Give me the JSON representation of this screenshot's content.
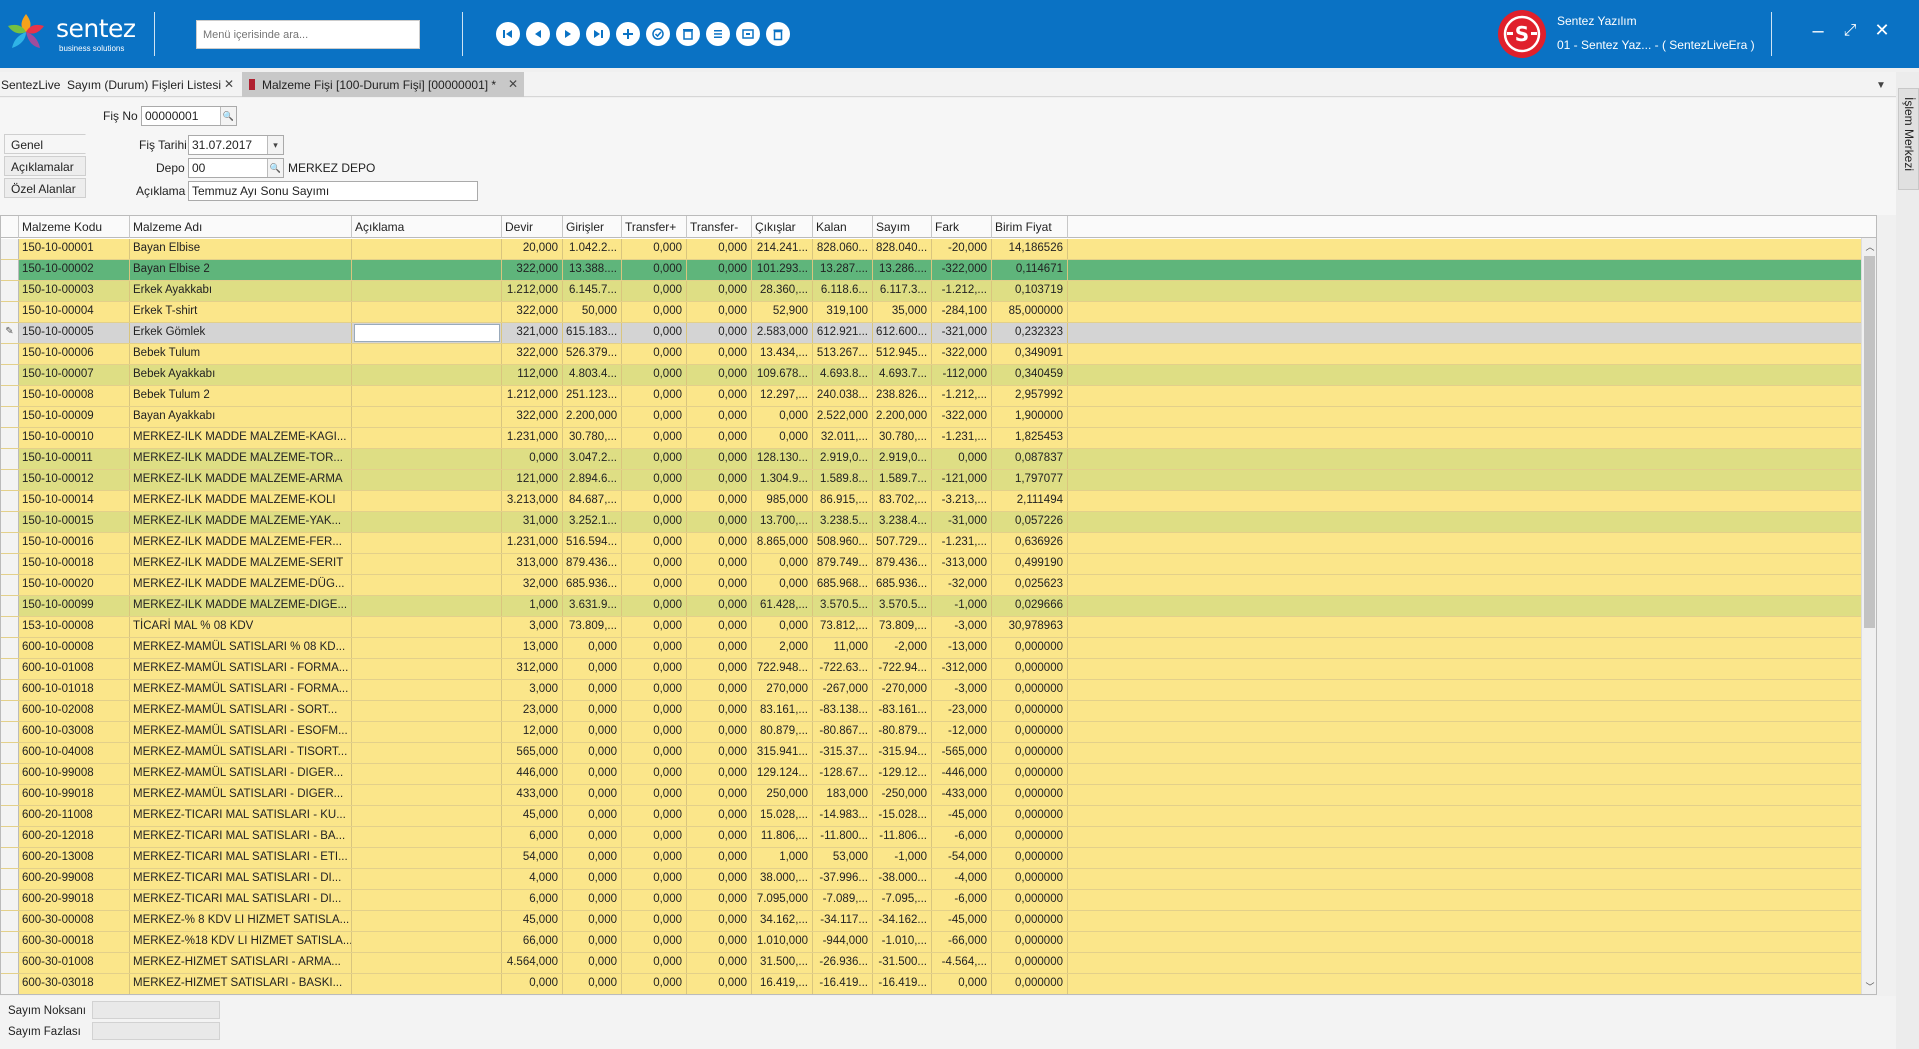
{
  "brand": {
    "name": "sentez",
    "tagline": "business solutions"
  },
  "search": {
    "placeholder": "Menü içerisinde ara..."
  },
  "nav_icons": [
    "first-icon",
    "prev-icon",
    "play-icon",
    "last-icon",
    "add-icon",
    "approve-icon",
    "delete-icon",
    "list-icon",
    "copy-icon",
    "trash-icon"
  ],
  "user": {
    "name": "Sentez Yazılım",
    "firm": "01 - Sentez Yaz... - ( SentezLiveEra )"
  },
  "tabs": [
    {
      "label": "SentezLive"
    },
    {
      "label": "Sayım (Durum) Fişleri Listesi"
    },
    {
      "label": "Malzeme Fişi [100-Durum Fişi]  [00000001]  *"
    }
  ],
  "side_panel": {
    "label": "İşlem Merkezi"
  },
  "form": {
    "fis_no_label": "Fiş No",
    "fis_no": "00000001",
    "fis_tarihi_label": "Fiş Tarihi",
    "fis_tarihi": "31.07.2017",
    "depo_label": "Depo",
    "depo": "00",
    "depo_name": "MERKEZ DEPO",
    "aciklama_label": "Açıklama",
    "aciklama": "Temmuz Ayı Sonu Sayımı"
  },
  "side_tabs": [
    "Genel",
    "Açıklamalar",
    "Özel Alanlar"
  ],
  "columns": [
    "Malzeme Kodu",
    "Malzeme Adı",
    "Açıklama",
    "Devir",
    "Girişler",
    "Transfer+",
    "Transfer-",
    "Çıkışlar",
    "Kalan",
    "Sayım",
    "Fark",
    "Birim Fiyat"
  ],
  "row_colors": {
    "yellow": "#fbe68a",
    "green_light": "#dede84",
    "green_selected": "#5fb57b",
    "gray_edit": "#d4d4d4"
  },
  "rows": [
    {
      "kod": "150-10-00001",
      "ad": "Bayan Elbise",
      "aciklama": "",
      "devir": "20,000",
      "girisler": "1.042.2...",
      "tplus": "0,000",
      "tminus": "0,000",
      "cikislar": "214.241...",
      "kalan": "828.060...",
      "sayim": "828.040...",
      "fark": "-20,000",
      "fiyat": "14,186526",
      "style": "yellow"
    },
    {
      "kod": "150-10-00002",
      "ad": "Bayan Elbise 2",
      "aciklama": "",
      "devir": "322,000",
      "girisler": "13.388....",
      "tplus": "0,000",
      "tminus": "0,000",
      "cikislar": "101.293...",
      "kalan": "13.287....",
      "sayim": "13.286....",
      "fark": "-322,000",
      "fiyat": "0,114671",
      "style": "green_selected"
    },
    {
      "kod": "150-10-00003",
      "ad": "Erkek Ayakkabı",
      "aciklama": "",
      "devir": "1.212,000",
      "girisler": "6.145.7...",
      "tplus": "0,000",
      "tminus": "0,000",
      "cikislar": "28.360,...",
      "kalan": "6.118.6...",
      "sayim": "6.117.3...",
      "fark": "-1.212,...",
      "fiyat": "0,103719",
      "style": "green_light"
    },
    {
      "kod": "150-10-00004",
      "ad": "Erkek T-shirt",
      "aciklama": "",
      "devir": "322,000",
      "girisler": "50,000",
      "tplus": "0,000",
      "tminus": "0,000",
      "cikislar": "52,900",
      "kalan": "319,100",
      "sayim": "35,000",
      "fark": "-284,100",
      "fiyat": "85,000000",
      "style": "yellow"
    },
    {
      "kod": "150-10-00005",
      "ad": "Erkek Gömlek",
      "aciklama": "",
      "devir": "321,000",
      "girisler": "615.183...",
      "tplus": "0,000",
      "tminus": "0,000",
      "cikislar": "2.583,000",
      "kalan": "612.921...",
      "sayim": "612.600...",
      "fark": "-321,000",
      "fiyat": "0,232323",
      "style": "gray_edit"
    },
    {
      "kod": "150-10-00006",
      "ad": "Bebek Tulum",
      "aciklama": "",
      "devir": "322,000",
      "girisler": "526.379...",
      "tplus": "0,000",
      "tminus": "0,000",
      "cikislar": "13.434,...",
      "kalan": "513.267...",
      "sayim": "512.945...",
      "fark": "-322,000",
      "fiyat": "0,349091",
      "style": "yellow"
    },
    {
      "kod": "150-10-00007",
      "ad": "Bebek Ayakkabı",
      "aciklama": "",
      "devir": "112,000",
      "girisler": "4.803.4...",
      "tplus": "0,000",
      "tminus": "0,000",
      "cikislar": "109.678...",
      "kalan": "4.693.8...",
      "sayim": "4.693.7...",
      "fark": "-112,000",
      "fiyat": "0,340459",
      "style": "green_light"
    },
    {
      "kod": "150-10-00008",
      "ad": "Bebek Tulum 2",
      "aciklama": "",
      "devir": "1.212,000",
      "girisler": "251.123...",
      "tplus": "0,000",
      "tminus": "0,000",
      "cikislar": "12.297,...",
      "kalan": "240.038...",
      "sayim": "238.826...",
      "fark": "-1.212,...",
      "fiyat": "2,957992",
      "style": "yellow"
    },
    {
      "kod": "150-10-00009",
      "ad": "Bayan Ayakkabı",
      "aciklama": "",
      "devir": "322,000",
      "girisler": "2.200,000",
      "tplus": "0,000",
      "tminus": "0,000",
      "cikislar": "0,000",
      "kalan": "2.522,000",
      "sayim": "2.200,000",
      "fark": "-322,000",
      "fiyat": "1,900000",
      "style": "yellow"
    },
    {
      "kod": "150-10-00010",
      "ad": "MERKEZ-ILK  MADDE MALZEME-KAGI...",
      "aciklama": "",
      "devir": "1.231,000",
      "girisler": "30.780,...",
      "tplus": "0,000",
      "tminus": "0,000",
      "cikislar": "0,000",
      "kalan": "32.011,...",
      "sayim": "30.780,...",
      "fark": "-1.231,...",
      "fiyat": "1,825453",
      "style": "yellow"
    },
    {
      "kod": "150-10-00011",
      "ad": "MERKEZ-ILK  MADDE MALZEME-TOR...",
      "aciklama": "",
      "devir": "0,000",
      "girisler": "3.047.2...",
      "tplus": "0,000",
      "tminus": "0,000",
      "cikislar": "128.130...",
      "kalan": "2.919,0...",
      "sayim": "2.919,0...",
      "fark": "0,000",
      "fiyat": "0,087837",
      "style": "green_light"
    },
    {
      "kod": "150-10-00012",
      "ad": "MERKEZ-ILK  MADDE MALZEME-ARMA",
      "aciklama": "",
      "devir": "121,000",
      "girisler": "2.894.6...",
      "tplus": "0,000",
      "tminus": "0,000",
      "cikislar": "1.304.9...",
      "kalan": "1.589.8...",
      "sayim": "1.589.7...",
      "fark": "-121,000",
      "fiyat": "1,797077",
      "style": "green_light"
    },
    {
      "kod": "150-10-00014",
      "ad": "MERKEZ-ILK  MADDE MALZEME-KOLI",
      "aciklama": "",
      "devir": "3.213,000",
      "girisler": "84.687,...",
      "tplus": "0,000",
      "tminus": "0,000",
      "cikislar": "985,000",
      "kalan": "86.915,...",
      "sayim": "83.702,...",
      "fark": "-3.213,...",
      "fiyat": "2,111494",
      "style": "yellow"
    },
    {
      "kod": "150-10-00015",
      "ad": "MERKEZ-ILK  MADDE MALZEME-YAK...",
      "aciklama": "",
      "devir": "31,000",
      "girisler": "3.252.1...",
      "tplus": "0,000",
      "tminus": "0,000",
      "cikislar": "13.700,...",
      "kalan": "3.238.5...",
      "sayim": "3.238.4...",
      "fark": "-31,000",
      "fiyat": "0,057226",
      "style": "green_light"
    },
    {
      "kod": "150-10-00016",
      "ad": "MERKEZ-ILK  MADDE MALZEME-FER...",
      "aciklama": "",
      "devir": "1.231,000",
      "girisler": "516.594...",
      "tplus": "0,000",
      "tminus": "0,000",
      "cikislar": "8.865,000",
      "kalan": "508.960...",
      "sayim": "507.729...",
      "fark": "-1.231,...",
      "fiyat": "0,636926",
      "style": "yellow"
    },
    {
      "kod": "150-10-00018",
      "ad": "MERKEZ-ILK  MADDE MALZEME-SERIT",
      "aciklama": "",
      "devir": "313,000",
      "girisler": "879.436...",
      "tplus": "0,000",
      "tminus": "0,000",
      "cikislar": "0,000",
      "kalan": "879.749...",
      "sayim": "879.436...",
      "fark": "-313,000",
      "fiyat": "0,499190",
      "style": "yellow"
    },
    {
      "kod": "150-10-00020",
      "ad": "MERKEZ-ILK  MADDE MALZEME-DÜG...",
      "aciklama": "",
      "devir": "32,000",
      "girisler": "685.936...",
      "tplus": "0,000",
      "tminus": "0,000",
      "cikislar": "0,000",
      "kalan": "685.968...",
      "sayim": "685.936...",
      "fark": "-32,000",
      "fiyat": "0,025623",
      "style": "yellow"
    },
    {
      "kod": "150-10-00099",
      "ad": "MERKEZ-ILK  MADDE MALZEME-DIGE...",
      "aciklama": "",
      "devir": "1,000",
      "girisler": "3.631.9...",
      "tplus": "0,000",
      "tminus": "0,000",
      "cikislar": "61.428,...",
      "kalan": "3.570.5...",
      "sayim": "3.570.5...",
      "fark": "-1,000",
      "fiyat": "0,029666",
      "style": "green_light"
    },
    {
      "kod": "153-10-00008",
      "ad": "TİCARİ MAL  % 08 KDV",
      "aciklama": "",
      "devir": "3,000",
      "girisler": "73.809,...",
      "tplus": "0,000",
      "tminus": "0,000",
      "cikislar": "0,000",
      "kalan": "73.812,...",
      "sayim": "73.809,...",
      "fark": "-3,000",
      "fiyat": "30,978963",
      "style": "yellow"
    },
    {
      "kod": "600-10-00008",
      "ad": "MERKEZ-MAMÜL SATISLARI  % 08 KD...",
      "aciklama": "",
      "devir": "13,000",
      "girisler": "0,000",
      "tplus": "0,000",
      "tminus": "0,000",
      "cikislar": "2,000",
      "kalan": "11,000",
      "sayim": "-2,000",
      "fark": "-13,000",
      "fiyat": "0,000000",
      "style": "yellow"
    },
    {
      "kod": "600-10-01008",
      "ad": "MERKEZ-MAMÜL SATISLARI - FORMA...",
      "aciklama": "",
      "devir": "312,000",
      "girisler": "0,000",
      "tplus": "0,000",
      "tminus": "0,000",
      "cikislar": "722.948...",
      "kalan": "-722.63...",
      "sayim": "-722.94...",
      "fark": "-312,000",
      "fiyat": "0,000000",
      "style": "yellow"
    },
    {
      "kod": "600-10-01018",
      "ad": "MERKEZ-MAMÜL SATISLARI - FORMA...",
      "aciklama": "",
      "devir": "3,000",
      "girisler": "0,000",
      "tplus": "0,000",
      "tminus": "0,000",
      "cikislar": "270,000",
      "kalan": "-267,000",
      "sayim": "-270,000",
      "fark": "-3,000",
      "fiyat": "0,000000",
      "style": "yellow"
    },
    {
      "kod": "600-10-02008",
      "ad": "MERKEZ-MAMÜL SATISLARI - SORT...",
      "aciklama": "",
      "devir": "23,000",
      "girisler": "0,000",
      "tplus": "0,000",
      "tminus": "0,000",
      "cikislar": "83.161,...",
      "kalan": "-83.138...",
      "sayim": "-83.161...",
      "fark": "-23,000",
      "fiyat": "0,000000",
      "style": "yellow"
    },
    {
      "kod": "600-10-03008",
      "ad": "MERKEZ-MAMÜL SATISLARI - ESOFM...",
      "aciklama": "",
      "devir": "12,000",
      "girisler": "0,000",
      "tplus": "0,000",
      "tminus": "0,000",
      "cikislar": "80.879,...",
      "kalan": "-80.867...",
      "sayim": "-80.879...",
      "fark": "-12,000",
      "fiyat": "0,000000",
      "style": "yellow"
    },
    {
      "kod": "600-10-04008",
      "ad": "MERKEZ-MAMÜL SATISLARI - TISORT...",
      "aciklama": "",
      "devir": "565,000",
      "girisler": "0,000",
      "tplus": "0,000",
      "tminus": "0,000",
      "cikislar": "315.941...",
      "kalan": "-315.37...",
      "sayim": "-315.94...",
      "fark": "-565,000",
      "fiyat": "0,000000",
      "style": "yellow"
    },
    {
      "kod": "600-10-99008",
      "ad": "MERKEZ-MAMÜL SATISLARI - DIGER...",
      "aciklama": "",
      "devir": "446,000",
      "girisler": "0,000",
      "tplus": "0,000",
      "tminus": "0,000",
      "cikislar": "129.124...",
      "kalan": "-128.67...",
      "sayim": "-129.12...",
      "fark": "-446,000",
      "fiyat": "0,000000",
      "style": "yellow"
    },
    {
      "kod": "600-10-99018",
      "ad": "MERKEZ-MAMÜL SATISLARI - DIGER...",
      "aciklama": "",
      "devir": "433,000",
      "girisler": "0,000",
      "tplus": "0,000",
      "tminus": "0,000",
      "cikislar": "250,000",
      "kalan": "183,000",
      "sayim": "-250,000",
      "fark": "-433,000",
      "fiyat": "0,000000",
      "style": "yellow"
    },
    {
      "kod": "600-20-11008",
      "ad": "MERKEZ-TICARI  MAL SATISLARI - KU...",
      "aciklama": "",
      "devir": "45,000",
      "girisler": "0,000",
      "tplus": "0,000",
      "tminus": "0,000",
      "cikislar": "15.028,...",
      "kalan": "-14.983...",
      "sayim": "-15.028...",
      "fark": "-45,000",
      "fiyat": "0,000000",
      "style": "yellow"
    },
    {
      "kod": "600-20-12018",
      "ad": "MERKEZ-TICARI  MAL SATISLARI - BA...",
      "aciklama": "",
      "devir": "6,000",
      "girisler": "0,000",
      "tplus": "0,000",
      "tminus": "0,000",
      "cikislar": "11.806,...",
      "kalan": "-11.800...",
      "sayim": "-11.806...",
      "fark": "-6,000",
      "fiyat": "0,000000",
      "style": "yellow"
    },
    {
      "kod": "600-20-13008",
      "ad": "MERKEZ-TICARI  MAL SATISLARI - ETI...",
      "aciklama": "",
      "devir": "54,000",
      "girisler": "0,000",
      "tplus": "0,000",
      "tminus": "0,000",
      "cikislar": "1,000",
      "kalan": "53,000",
      "sayim": "-1,000",
      "fark": "-54,000",
      "fiyat": "0,000000",
      "style": "yellow"
    },
    {
      "kod": "600-20-99008",
      "ad": "MERKEZ-TICARI  MAL SATISLARI - DI...",
      "aciklama": "",
      "devir": "4,000",
      "girisler": "0,000",
      "tplus": "0,000",
      "tminus": "0,000",
      "cikislar": "38.000,...",
      "kalan": "-37.996...",
      "sayim": "-38.000...",
      "fark": "-4,000",
      "fiyat": "0,000000",
      "style": "yellow"
    },
    {
      "kod": "600-20-99018",
      "ad": "MERKEZ-TICARI  MAL SATISLARI - DI...",
      "aciklama": "",
      "devir": "6,000",
      "girisler": "0,000",
      "tplus": "0,000",
      "tminus": "0,000",
      "cikislar": "7.095,000",
      "kalan": "-7.089,...",
      "sayim": "-7.095,...",
      "fark": "-6,000",
      "fiyat": "0,000000",
      "style": "yellow"
    },
    {
      "kod": "600-30-00008",
      "ad": "MERKEZ-%  8 KDV LI HIZMET SATISLA...",
      "aciklama": "",
      "devir": "45,000",
      "girisler": "0,000",
      "tplus": "0,000",
      "tminus": "0,000",
      "cikislar": "34.162,...",
      "kalan": "-34.117...",
      "sayim": "-34.162...",
      "fark": "-45,000",
      "fiyat": "0,000000",
      "style": "yellow"
    },
    {
      "kod": "600-30-00018",
      "ad": "MERKEZ-%18 KDV LI HIZMET SATISLA...",
      "aciklama": "",
      "devir": "66,000",
      "girisler": "0,000",
      "tplus": "0,000",
      "tminus": "0,000",
      "cikislar": "1.010,000",
      "kalan": "-944,000",
      "sayim": "-1.010,...",
      "fark": "-66,000",
      "fiyat": "0,000000",
      "style": "yellow"
    },
    {
      "kod": "600-30-01008",
      "ad": "MERKEZ-HIZMET  SATISLARI - ARMA...",
      "aciklama": "",
      "devir": "4.564,000",
      "girisler": "0,000",
      "tplus": "0,000",
      "tminus": "0,000",
      "cikislar": "31.500,...",
      "kalan": "-26.936...",
      "sayim": "-31.500...",
      "fark": "-4.564,...",
      "fiyat": "0,000000",
      "style": "yellow"
    },
    {
      "kod": "600-30-03018",
      "ad": "MERKEZ-HIZMET  SATISLARI - BASKI...",
      "aciklama": "",
      "devir": "0,000",
      "girisler": "0,000",
      "tplus": "0,000",
      "tminus": "0,000",
      "cikislar": "16.419,...",
      "kalan": "-16.419...",
      "sayim": "-16.419...",
      "fark": "0,000",
      "fiyat": "0,000000",
      "style": "yellow"
    }
  ],
  "footer": {
    "noksan_label": "Sayım Noksanı",
    "fazla_label": "Sayım Fazlası"
  }
}
